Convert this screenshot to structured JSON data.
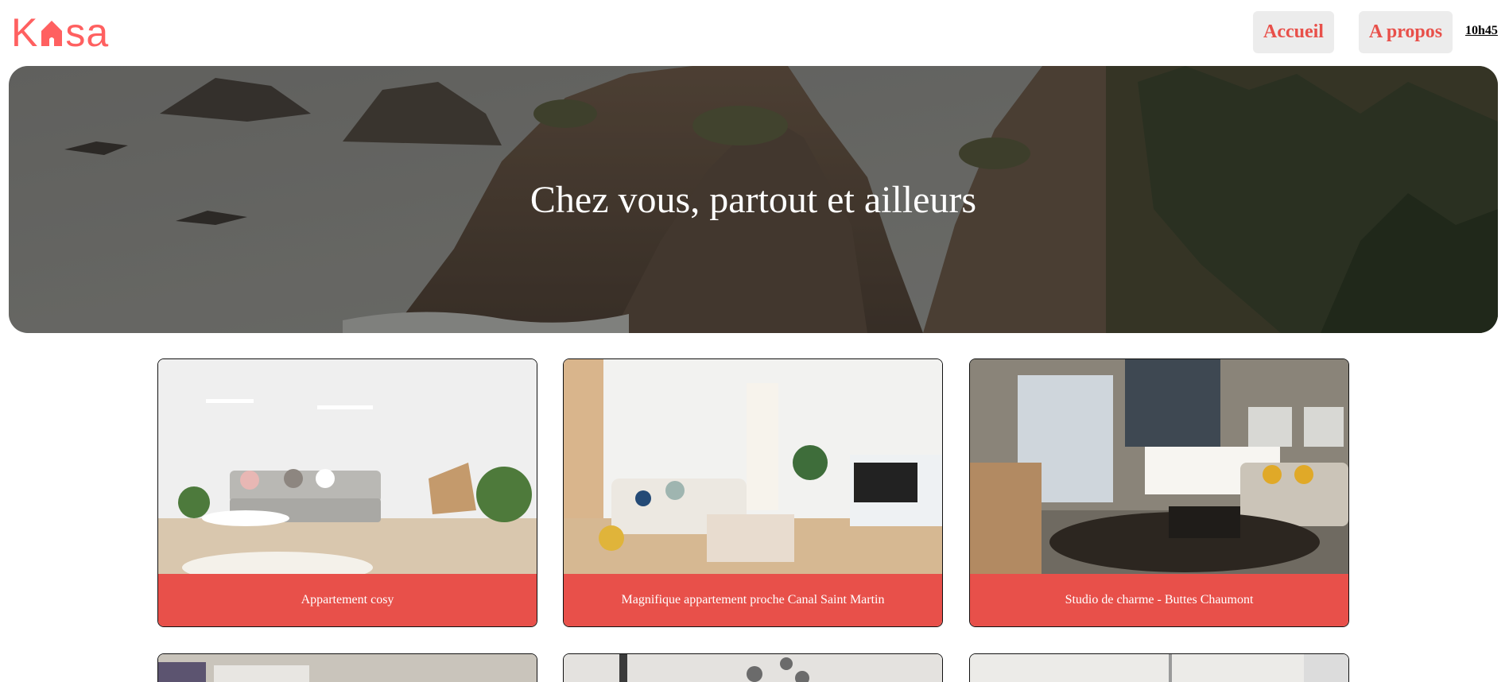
{
  "brand": {
    "logo_left": "K",
    "logo_right": "sa",
    "color": "#FF6060"
  },
  "nav": {
    "home_label": "Accueil",
    "about_label": "A propos",
    "time": "10h45"
  },
  "banner": {
    "title": "Chez vous, partout et ailleurs"
  },
  "listings": [
    {
      "title": "Appartement cosy"
    },
    {
      "title": "Magnifique appartement proche Canal Saint Martin"
    },
    {
      "title": "Studio de charme - Buttes Chaumont"
    }
  ],
  "colors": {
    "accent": "#E8504A",
    "nav_bg": "#ececec"
  }
}
